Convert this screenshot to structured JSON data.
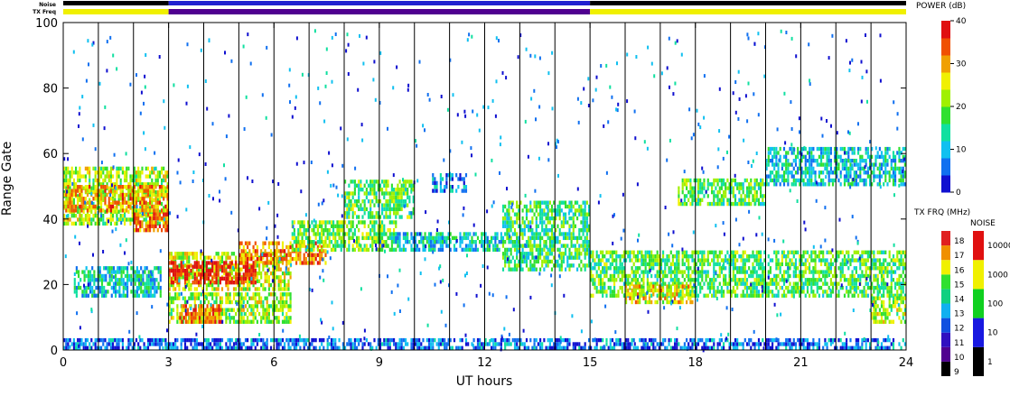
{
  "chart_data": {
    "type": "heatmap",
    "title": "",
    "xlabel": "UT hours",
    "ylabel": "Range Gate",
    "xlim": [
      0,
      24
    ],
    "ylim": [
      0,
      100
    ],
    "x_ticks": [
      "0",
      "3",
      "6",
      "9",
      "12",
      "15",
      "18",
      "21",
      "24"
    ],
    "x_tick_values": [
      0,
      3,
      6,
      9,
      12,
      15,
      18,
      21,
      24
    ],
    "y_ticks": [
      "0",
      "20",
      "40",
      "60",
      "80",
      "100"
    ],
    "y_tick_values": [
      0,
      20,
      40,
      60,
      80,
      100
    ],
    "scan_boundaries_ut": [
      1,
      2,
      3,
      4,
      5,
      6,
      7,
      8,
      9,
      10,
      11,
      12,
      13,
      14,
      15,
      16,
      17,
      18,
      19,
      20,
      21,
      22,
      23
    ],
    "header_bars": {
      "noise_label": "Noise",
      "txfreq_label": "TX Freq",
      "noise_segments": [
        {
          "from": 0,
          "to": 3,
          "color": "#000000"
        },
        {
          "from": 3,
          "to": 15,
          "color": "#2020d0"
        },
        {
          "from": 15,
          "to": 24,
          "color": "#000000"
        }
      ],
      "txfreq_segments": [
        {
          "from": 0,
          "to": 3,
          "color": "#f0f000"
        },
        {
          "from": 3,
          "to": 15,
          "color": "#500090"
        },
        {
          "from": 15,
          "to": 24,
          "color": "#f0f000"
        }
      ]
    },
    "bands": [
      {
        "x0": 0.0,
        "x1": 3.0,
        "y0": 38,
        "y1": 56,
        "level": 0.55
      },
      {
        "x0": 0.0,
        "x1": 3.0,
        "y0": 42,
        "y1": 50,
        "level": 0.75
      },
      {
        "x0": 2.0,
        "x1": 3.0,
        "y0": 36,
        "y1": 42,
        "level": 0.85
      },
      {
        "x0": 0.3,
        "x1": 2.8,
        "y0": 16,
        "y1": 26,
        "level": 0.3
      },
      {
        "x0": 3.0,
        "x1": 6.5,
        "y0": 18,
        "y1": 30,
        "level": 0.6
      },
      {
        "x0": 3.0,
        "x1": 5.5,
        "y0": 20,
        "y1": 27,
        "level": 0.98
      },
      {
        "x0": 5.0,
        "x1": 7.5,
        "y0": 26,
        "y1": 33,
        "level": 0.8
      },
      {
        "x0": 6.5,
        "x1": 9.5,
        "y0": 30,
        "y1": 40,
        "level": 0.5
      },
      {
        "x0": 8.0,
        "x1": 10.0,
        "y0": 40,
        "y1": 52,
        "level": 0.45
      },
      {
        "x0": 9.0,
        "x1": 12.5,
        "y0": 30,
        "y1": 36,
        "level": 0.3
      },
      {
        "x0": 3.0,
        "x1": 6.5,
        "y0": 8,
        "y1": 18,
        "level": 0.55
      },
      {
        "x0": 3.3,
        "x1": 4.5,
        "y0": 8,
        "y1": 14,
        "level": 0.8
      },
      {
        "x0": 12.5,
        "x1": 15.0,
        "y0": 24,
        "y1": 45,
        "level": 0.4
      },
      {
        "x0": 15.0,
        "x1": 24.0,
        "y0": 16,
        "y1": 30,
        "level": 0.45
      },
      {
        "x0": 16.0,
        "x1": 18.0,
        "y0": 14,
        "y1": 20,
        "level": 0.65
      },
      {
        "x0": 17.5,
        "x1": 20.0,
        "y0": 44,
        "y1": 52,
        "level": 0.45
      },
      {
        "x0": 20.0,
        "x1": 24.0,
        "y0": 50,
        "y1": 62,
        "level": 0.3
      },
      {
        "x0": 23.0,
        "x1": 24.0,
        "y0": 8,
        "y1": 16,
        "level": 0.55
      },
      {
        "x0": 10.5,
        "x1": 11.5,
        "y0": 48,
        "y1": 54,
        "level": 0.2
      },
      {
        "x0": 0.0,
        "x1": 24.0,
        "y0": 0,
        "y1": 4,
        "level": 0.15
      }
    ],
    "power_colorbar": {
      "title": "POWER (dB)",
      "min": 0,
      "max": 40,
      "ticks": [
        "0",
        "10",
        "20",
        "30",
        "40"
      ]
    },
    "txfreq_colorbar": {
      "title": "TX FRQ (MHz)",
      "ticks": [
        "9",
        "10",
        "11",
        "12",
        "13",
        "14",
        "15",
        "16",
        "17",
        "18"
      ]
    },
    "noise_colorbar": {
      "title": "NOISE",
      "ticks": [
        "1",
        "10",
        "100",
        "1000",
        "10000"
      ]
    },
    "colors": {
      "power_scale": [
        "#1010d0",
        "#1070f0",
        "#10c0f0",
        "#10e0a0",
        "#30e030",
        "#a0f000",
        "#f0f000",
        "#f0a000",
        "#f05000",
        "#e01010"
      ],
      "txfreq_scale": [
        "#000000",
        "#500090",
        "#3010c0",
        "#1050e0",
        "#10b0f0",
        "#10d080",
        "#30e030",
        "#f0f000",
        "#f09000",
        "#e02020"
      ],
      "noise_scale": [
        "#000000",
        "#1818e0",
        "#10d020",
        "#f0f000",
        "#e01010"
      ]
    }
  }
}
